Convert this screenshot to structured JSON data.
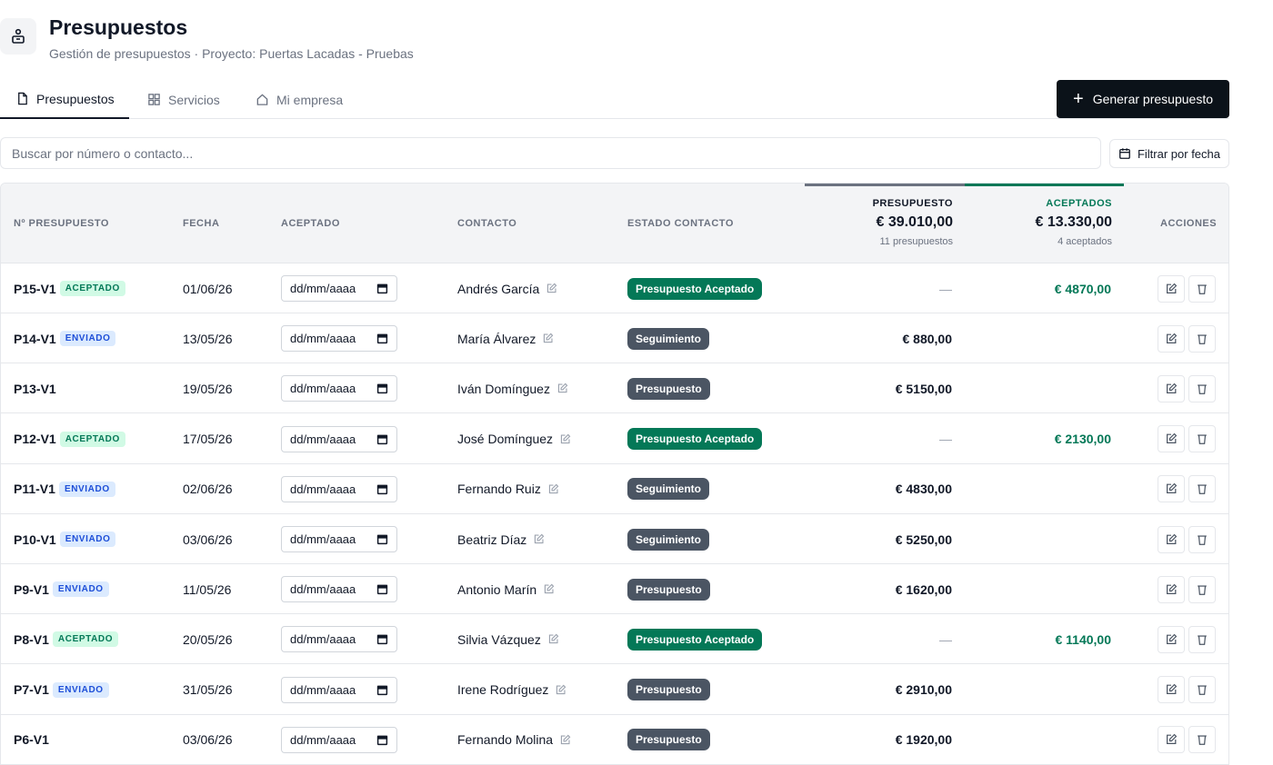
{
  "header": {
    "title": "Presupuestos",
    "subtitle": "Gestión de presupuestos · Proyecto: Puertas Lacadas - Pruebas",
    "icon": "briefcase-icon"
  },
  "tabs": [
    {
      "label": "Presupuestos",
      "icon": "file-icon",
      "active": true
    },
    {
      "label": "Servicios",
      "icon": "grid-icon",
      "active": false
    },
    {
      "label": "Mi empresa",
      "icon": "home-icon",
      "active": false
    }
  ],
  "actions": {
    "generate_label": "Generar presupuesto",
    "filter_label": "Filtrar por fecha"
  },
  "search": {
    "placeholder": "Buscar por número o contacto...",
    "value": ""
  },
  "table": {
    "columns": {
      "number": "Nº PRESUPUESTO",
      "date": "FECHA",
      "accepted": "ACEPTADO",
      "contact": "CONTACTO",
      "status": "ESTADO CONTACTO",
      "actions": "ACCIONES"
    },
    "summary": {
      "presupuesto_label": "PRESUPUESTO",
      "presupuesto_total": "€ 39.010,00",
      "presupuesto_count": "11 presupuestos",
      "aceptados_label": "ACEPTADOS",
      "aceptados_total": "€ 13.330,00",
      "aceptados_count": "4 aceptados"
    },
    "date_placeholder": "dd/mm/aaaa",
    "rows": [
      {
        "num": "P15-V1",
        "badge": "ACEPTADO",
        "date": "01/06/26",
        "contact": "Andrés García",
        "status": "Presupuesto Aceptado",
        "presupuesto": "—",
        "aceptado": "€ 4870,00"
      },
      {
        "num": "P14-V1",
        "badge": "ENVIADO",
        "date": "13/05/26",
        "contact": "María Álvarez",
        "status": "Seguimiento",
        "presupuesto": "€ 880,00",
        "aceptado": ""
      },
      {
        "num": "P13-V1",
        "badge": "",
        "date": "19/05/26",
        "contact": "Iván Domínguez",
        "status": "Presupuesto",
        "presupuesto": "€ 5150,00",
        "aceptado": ""
      },
      {
        "num": "P12-V1",
        "badge": "ACEPTADO",
        "date": "17/05/26",
        "contact": "José Domínguez",
        "status": "Presupuesto Aceptado",
        "presupuesto": "—",
        "aceptado": "€ 2130,00"
      },
      {
        "num": "P11-V1",
        "badge": "ENVIADO",
        "date": "02/06/26",
        "contact": "Fernando Ruiz",
        "status": "Seguimiento",
        "presupuesto": "€ 4830,00",
        "aceptado": ""
      },
      {
        "num": "P10-V1",
        "badge": "ENVIADO",
        "date": "03/06/26",
        "contact": "Beatriz Díaz",
        "status": "Seguimiento",
        "presupuesto": "€ 5250,00",
        "aceptado": ""
      },
      {
        "num": "P9-V1",
        "badge": "ENVIADO",
        "date": "11/05/26",
        "contact": "Antonio Marín",
        "status": "Presupuesto",
        "presupuesto": "€ 1620,00",
        "aceptado": ""
      },
      {
        "num": "P8-V1",
        "badge": "ACEPTADO",
        "date": "20/05/26",
        "contact": "Silvia Vázquez",
        "status": "Presupuesto Aceptado",
        "presupuesto": "—",
        "aceptado": "€ 1140,00"
      },
      {
        "num": "P7-V1",
        "badge": "ENVIADO",
        "date": "31/05/26",
        "contact": "Irene Rodríguez",
        "status": "Presupuesto",
        "presupuesto": "€ 2910,00",
        "aceptado": ""
      },
      {
        "num": "P6-V1",
        "badge": "",
        "date": "03/06/26",
        "contact": "Fernando Molina",
        "status": "Presupuesto",
        "presupuesto": "€ 1920,00",
        "aceptado": ""
      }
    ]
  },
  "colors": {
    "accent_dark": "#0b1219",
    "accepted_green": "#047857",
    "status_gray": "#4b5563",
    "badge_accepted_bg": "#d1fae5",
    "badge_accepted_fg": "#047857",
    "badge_sent_bg": "#dbeafe",
    "badge_sent_fg": "#1d4ed8"
  }
}
